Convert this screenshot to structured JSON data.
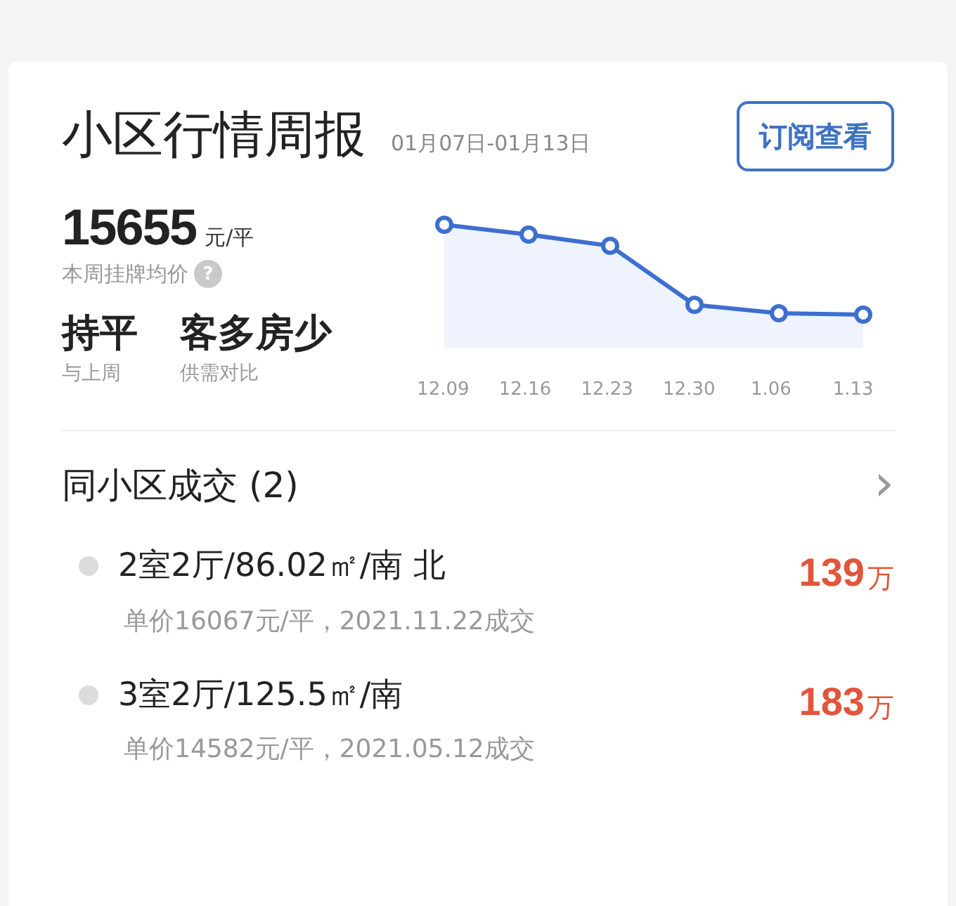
{
  "report": {
    "title": "小区行情周报",
    "date_range": "01月07日-01月13日",
    "subscribe_button": "订阅查看"
  },
  "listing_price": {
    "value": "15655",
    "unit": "元/平",
    "label": "本周挂牌均价",
    "help_icon": "?"
  },
  "stats": [
    {
      "value": "持平",
      "label": "与上周"
    },
    {
      "value": "客多房少",
      "label": "供需对比"
    }
  ],
  "trend_x_labels": [
    "12.09",
    "12.16",
    "12.23",
    "12.30",
    "1.06",
    "1.13"
  ],
  "deals": {
    "title": "同小区成交 (2)",
    "chevron": "›",
    "items": [
      {
        "layout": "2室2厅/86.02㎡/南 北",
        "detail": "单价16067元/平，2021.11.22成交",
        "price": "139",
        "price_unit": "万"
      },
      {
        "layout": "3室2厅/125.5㎡/南",
        "detail": "单价14582元/平，2021.05.12成交",
        "price": "183",
        "price_unit": "万"
      }
    ]
  }
}
